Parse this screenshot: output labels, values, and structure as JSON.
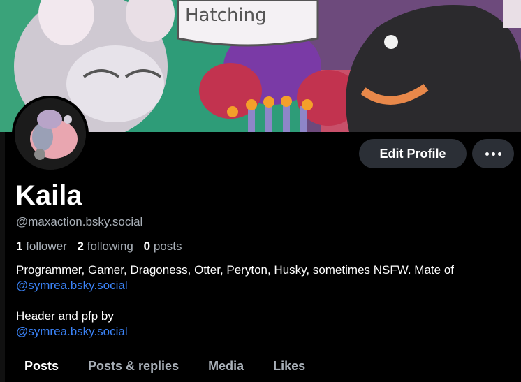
{
  "profile": {
    "display_name": "Kaila",
    "handle": "@maxaction.bsky.social",
    "stats": {
      "followers_count": "1",
      "followers_label": "follower",
      "following_count": "2",
      "following_label": "following",
      "posts_count": "0",
      "posts_label": "posts"
    },
    "bio": {
      "line1": "Programmer, Gamer,  Dragoness, Otter, Peryton, Husky, sometimes NSFW. Mate of",
      "mention1": "@symrea.bsky.social",
      "line2": "Header and pfp by",
      "mention2": "@symrea.bsky.social"
    }
  },
  "actions": {
    "edit_profile_label": "Edit Profile",
    "more_icon": "more-horizontal-icon"
  },
  "tabs": [
    {
      "label": "Posts",
      "active": true
    },
    {
      "label": "Posts & replies",
      "active": false
    },
    {
      "label": "Media",
      "active": false
    },
    {
      "label": "Likes",
      "active": false
    }
  ],
  "colors": {
    "background": "#000000",
    "button_bg": "#2b2f36",
    "link": "#3b83f7",
    "muted_text": "#a9b0b8"
  }
}
